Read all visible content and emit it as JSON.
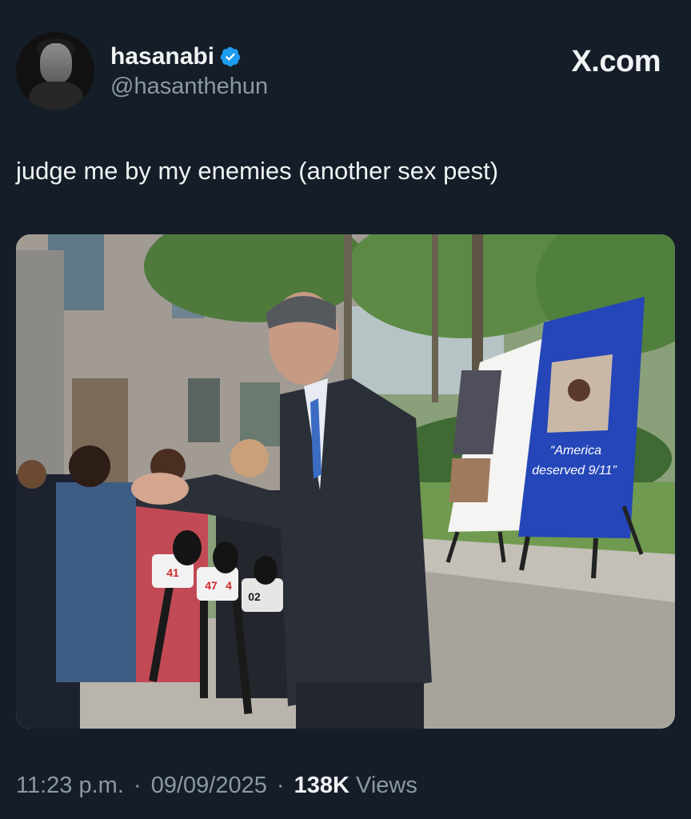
{
  "user": {
    "display_name": "hasanabi",
    "handle": "@hasanthehun",
    "verified": true,
    "verified_color": "#1d9bf0"
  },
  "brand": {
    "label": "X.com"
  },
  "tweet": {
    "text": "judge me by my enemies (another sex pest)"
  },
  "photo": {
    "sign_text_line1": "“America",
    "sign_text_line2": "deserved 9/11”",
    "mic_labels": [
      "41",
      "47",
      "4",
      "02"
    ]
  },
  "meta": {
    "time": "11:23 p.m.",
    "separator": "·",
    "date": "09/09/2025",
    "views_count": "138K",
    "views_label": "Views"
  },
  "colors": {
    "background": "#151d28",
    "text_primary": "#f0f3f4",
    "text_secondary": "#8b98a5"
  }
}
